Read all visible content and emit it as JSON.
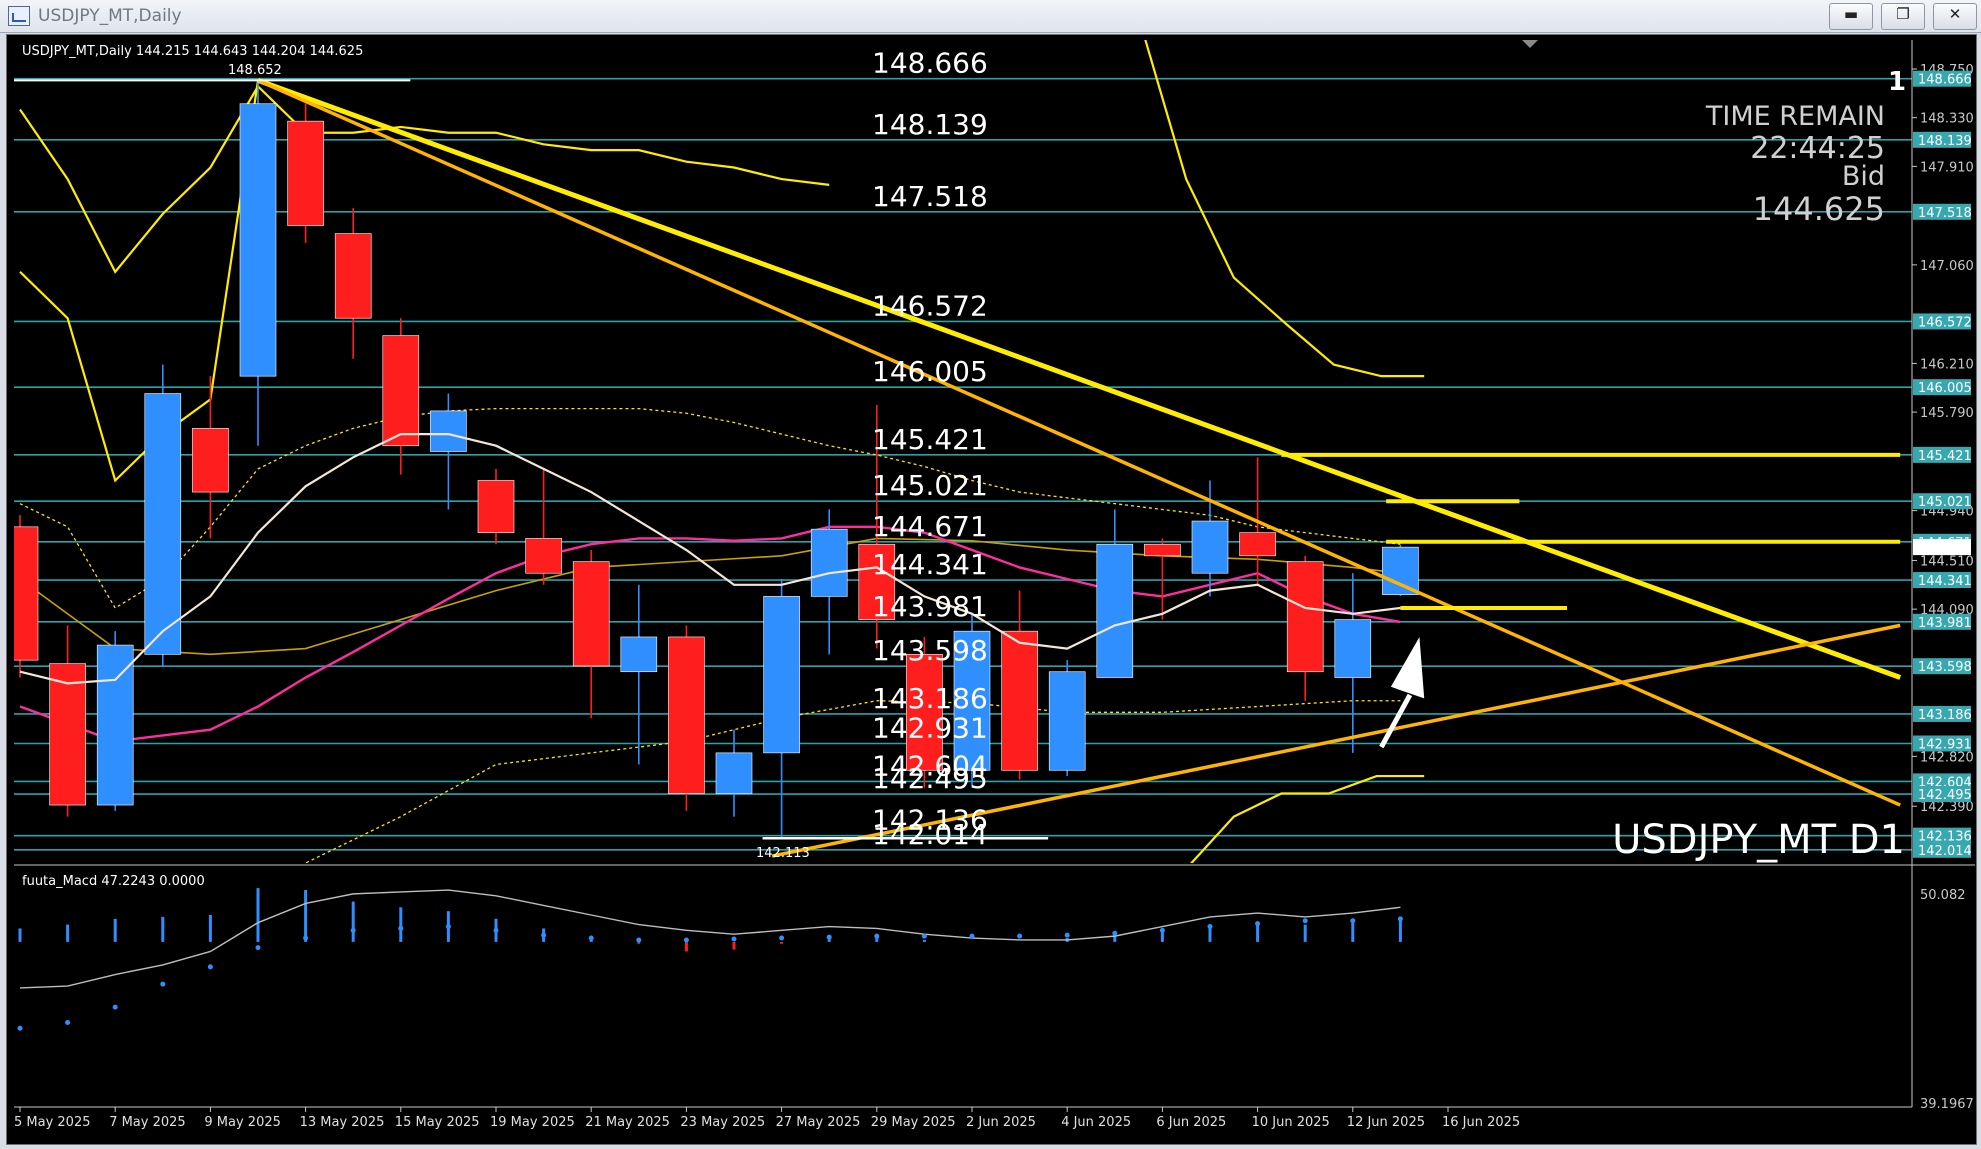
{
  "window": {
    "title": "USDJPY_MT,Daily",
    "buttons": {
      "minimize": "▬",
      "restore": "❐",
      "close": "✕"
    }
  },
  "chart_header": {
    "symbol_period": "USDJPY_MT,Daily",
    "ohlc": "144.215 144.643 144.204 144.625",
    "high_label": "148.652",
    "low_label": "142.113",
    "watermark": "USDJPY_MT D1",
    "top_right_glyph": "1"
  },
  "info_panel": {
    "time_label": "TIME REMAIN",
    "time_value": "22:44:25",
    "bid_label": "Bid",
    "bid_value": "144.625"
  },
  "macd_header": "fuuta_Macd 47.2243   0.0000",
  "colors": {
    "background": "#000000",
    "bull": "#2f8fff",
    "bear": "#ff1e1e",
    "level_line": "#2ea0a8",
    "trend_line": "#ffec00",
    "trend_line_orange": "#ffb400",
    "ma_fast": "#f4e6d6",
    "ma_slow": "#ff2da0",
    "ma_dotted": "#ffe400",
    "axis_text": "#c8c8c8"
  },
  "chart_data": {
    "type": "candlestick",
    "title": "USDJPY_MT,Daily",
    "ylim": [
      141.9,
      149.0
    ],
    "y_ticks": [
      "148.750",
      "148.330",
      "147.910",
      "147.060",
      "146.210",
      "145.790",
      "144.940",
      "144.510",
      "144.090",
      "142.820",
      "142.390"
    ],
    "x_tick_labels": [
      "5 May 2025",
      "7 May 2025",
      "9 May 2025",
      "13 May 2025",
      "15 May 2025",
      "19 May 2025",
      "21 May 2025",
      "23 May 2025",
      "27 May 2025",
      "29 May 2025",
      "2 Jun 2025",
      "4 Jun 2025",
      "6 Jun 2025",
      "10 Jun 2025",
      "12 Jun 2025",
      "16 Jun 2025"
    ],
    "levels": [
      148.666,
      148.139,
      147.518,
      146.572,
      146.005,
      145.421,
      145.021,
      144.671,
      144.341,
      143.981,
      143.598,
      143.186,
      142.931,
      142.604,
      142.495,
      142.136,
      142.014
    ],
    "level_labels": [
      "148.666",
      "148.139",
      "147.518",
      "146.572",
      "146.005",
      "145.421",
      "145.021",
      "144.671",
      "144.341",
      "143.981",
      "143.598",
      "143.186",
      "142.931",
      "142.604",
      "142.495",
      "142.136",
      "142.014"
    ],
    "candles": [
      {
        "o": 144.8,
        "h": 144.9,
        "c": 143.65,
        "l": 143.5
      },
      {
        "o": 143.62,
        "h": 143.95,
        "c": 142.4,
        "l": 142.3
      },
      {
        "o": 142.4,
        "h": 143.9,
        "c": 143.78,
        "l": 142.35
      },
      {
        "o": 143.7,
        "h": 146.2,
        "c": 145.95,
        "l": 143.6
      },
      {
        "o": 145.65,
        "h": 146.1,
        "c": 145.1,
        "l": 144.7
      },
      {
        "o": 146.1,
        "h": 148.652,
        "c": 148.45,
        "l": 145.5
      },
      {
        "o": 148.3,
        "h": 148.45,
        "c": 147.4,
        "l": 147.25
      },
      {
        "o": 147.33,
        "h": 147.55,
        "c": 146.6,
        "l": 146.25
      },
      {
        "o": 146.45,
        "h": 146.6,
        "c": 145.5,
        "l": 145.25
      },
      {
        "o": 145.45,
        "h": 145.95,
        "c": 145.8,
        "l": 144.95
      },
      {
        "o": 145.2,
        "h": 145.3,
        "c": 144.75,
        "l": 144.65
      },
      {
        "o": 144.7,
        "h": 145.3,
        "c": 144.4,
        "l": 144.3
      },
      {
        "o": 144.5,
        "h": 144.6,
        "c": 143.6,
        "l": 143.15
      },
      {
        "o": 143.55,
        "h": 144.3,
        "c": 143.85,
        "l": 142.75
      },
      {
        "o": 143.85,
        "h": 143.95,
        "c": 142.5,
        "l": 142.35
      },
      {
        "o": 142.5,
        "h": 143.05,
        "c": 142.85,
        "l": 142.3
      },
      {
        "o": 142.85,
        "h": 144.35,
        "c": 144.2,
        "l": 142.113
      },
      {
        "o": 144.2,
        "h": 144.95,
        "c": 144.78,
        "l": 143.7
      },
      {
        "o": 144.65,
        "h": 145.85,
        "c": 144.0,
        "l": 143.75
      },
      {
        "o": 143.7,
        "h": 143.85,
        "c": 142.7,
        "l": 142.55
      },
      {
        "o": 142.7,
        "h": 144.05,
        "c": 143.9,
        "l": 142.55
      },
      {
        "o": 143.9,
        "h": 144.25,
        "c": 142.7,
        "l": 142.62
      },
      {
        "o": 142.7,
        "h": 143.65,
        "c": 143.55,
        "l": 142.65
      },
      {
        "o": 143.5,
        "h": 144.95,
        "c": 144.65,
        "l": 143.5
      },
      {
        "o": 144.65,
        "h": 144.7,
        "c": 144.55,
        "l": 144.0
      },
      {
        "o": 144.4,
        "h": 145.2,
        "c": 144.85,
        "l": 144.2
      },
      {
        "o": 144.75,
        "h": 145.4,
        "c": 144.55,
        "l": 144.3
      },
      {
        "o": 144.5,
        "h": 144.55,
        "c": 143.55,
        "l": 143.3
      },
      {
        "o": 143.5,
        "h": 144.4,
        "c": 144.0,
        "l": 142.85
      },
      {
        "o": 144.215,
        "h": 144.643,
        "c": 144.625,
        "l": 144.204
      }
    ],
    "ma_fast": [
      143.55,
      143.45,
      143.48,
      143.9,
      144.2,
      144.75,
      145.15,
      145.4,
      145.6,
      145.6,
      145.5,
      145.3,
      145.1,
      144.85,
      144.6,
      144.3,
      144.3,
      144.4,
      144.45,
      144.2,
      144.05,
      143.8,
      143.75,
      143.95,
      144.05,
      144.25,
      144.3,
      144.1,
      144.05,
      144.1
    ],
    "ma_slow": [
      143.25,
      143.1,
      142.95,
      143.0,
      143.05,
      143.25,
      143.5,
      143.72,
      143.95,
      144.18,
      144.4,
      144.55,
      144.65,
      144.7,
      144.7,
      144.68,
      144.7,
      144.8,
      144.8,
      144.75,
      144.6,
      144.45,
      144.35,
      144.25,
      144.2,
      144.3,
      144.4,
      144.2,
      144.05,
      143.98
    ],
    "ma_dotted": [
      145.0,
      144.8,
      144.1,
      144.35,
      144.8,
      145.3,
      145.5,
      145.65,
      145.75,
      145.8,
      145.82,
      145.82,
      145.82,
      145.82,
      145.78,
      145.7,
      145.6,
      145.5,
      145.42,
      145.32,
      145.2,
      145.1,
      145.05,
      145.0,
      144.95,
      144.9,
      144.8,
      144.75,
      144.7,
      144.65
    ],
    "envelope_upper": [
      148.4,
      147.8,
      147.0,
      147.5,
      147.9,
      148.6,
      148.2,
      148.2,
      148.25,
      148.2,
      148.2,
      148.1,
      148.05,
      148.05,
      147.95,
      147.9,
      147.8,
      147.75,
      147.7,
      147.6,
      147.55,
      147.5,
      147.4,
      147.4,
      146.8,
      146.2,
      145.8,
      145.5,
      145.3,
      145.3
    ],
    "trendlines_desc": [
      {
        "from": [
          5,
          148.652
        ],
        "to": [
          39.5,
          143.5
        ],
        "color": "trend_line"
      },
      {
        "from": [
          5,
          148.652
        ],
        "to": [
          39.5,
          142.4
        ],
        "color": "trend_line_orange"
      },
      {
        "from": [
          15.8,
          141.96
        ],
        "to": [
          39.5,
          143.95
        ],
        "color": "trend_line_orange"
      }
    ],
    "segments": [
      {
        "x1": 26.5,
        "x2": 39.5,
        "y": 145.421
      },
      {
        "x1": 28.7,
        "x2": 31.5,
        "y": 145.021
      },
      {
        "x1": 28.7,
        "x2": 39.5,
        "y": 144.671
      },
      {
        "x1": 29.0,
        "x2": 32.5,
        "y": 144.1
      }
    ],
    "macd": {
      "ylim": [
        39.0,
        51.5
      ],
      "y_ticks": [
        "50.082",
        "39.1967"
      ],
      "line": [
        45.2,
        45.3,
        45.9,
        46.4,
        47.1,
        48.6,
        49.6,
        50.1,
        50.2,
        50.3,
        50.0,
        49.5,
        49.0,
        48.5,
        48.2,
        48.0,
        48.2,
        48.4,
        48.3,
        48.0,
        47.8,
        47.7,
        47.7,
        47.9,
        48.4,
        48.9,
        49.1,
        48.9,
        49.1,
        49.4
      ],
      "hist": [
        48.3,
        48.5,
        48.8,
        48.9,
        49.0,
        50.4,
        50.3,
        49.7,
        49.4,
        49.2,
        48.8,
        48.3,
        47.8,
        47.5,
        47.1,
        47.2,
        47.5,
        47.8,
        47.8,
        47.7,
        47.6,
        47.6,
        47.8,
        48.0,
        48.2,
        48.5,
        48.6,
        48.5,
        48.6,
        48.7
      ],
      "signal_dots": [
        43.1,
        43.4,
        44.2,
        45.4,
        46.3,
        47.3,
        47.8,
        48.2,
        48.3,
        48.4,
        48.2,
        47.95,
        47.8,
        47.7,
        47.7,
        47.75,
        47.8,
        47.85,
        47.9,
        47.9,
        47.9,
        47.9,
        47.95,
        48.05,
        48.2,
        48.4,
        48.55,
        48.7,
        48.7,
        48.8
      ]
    }
  }
}
